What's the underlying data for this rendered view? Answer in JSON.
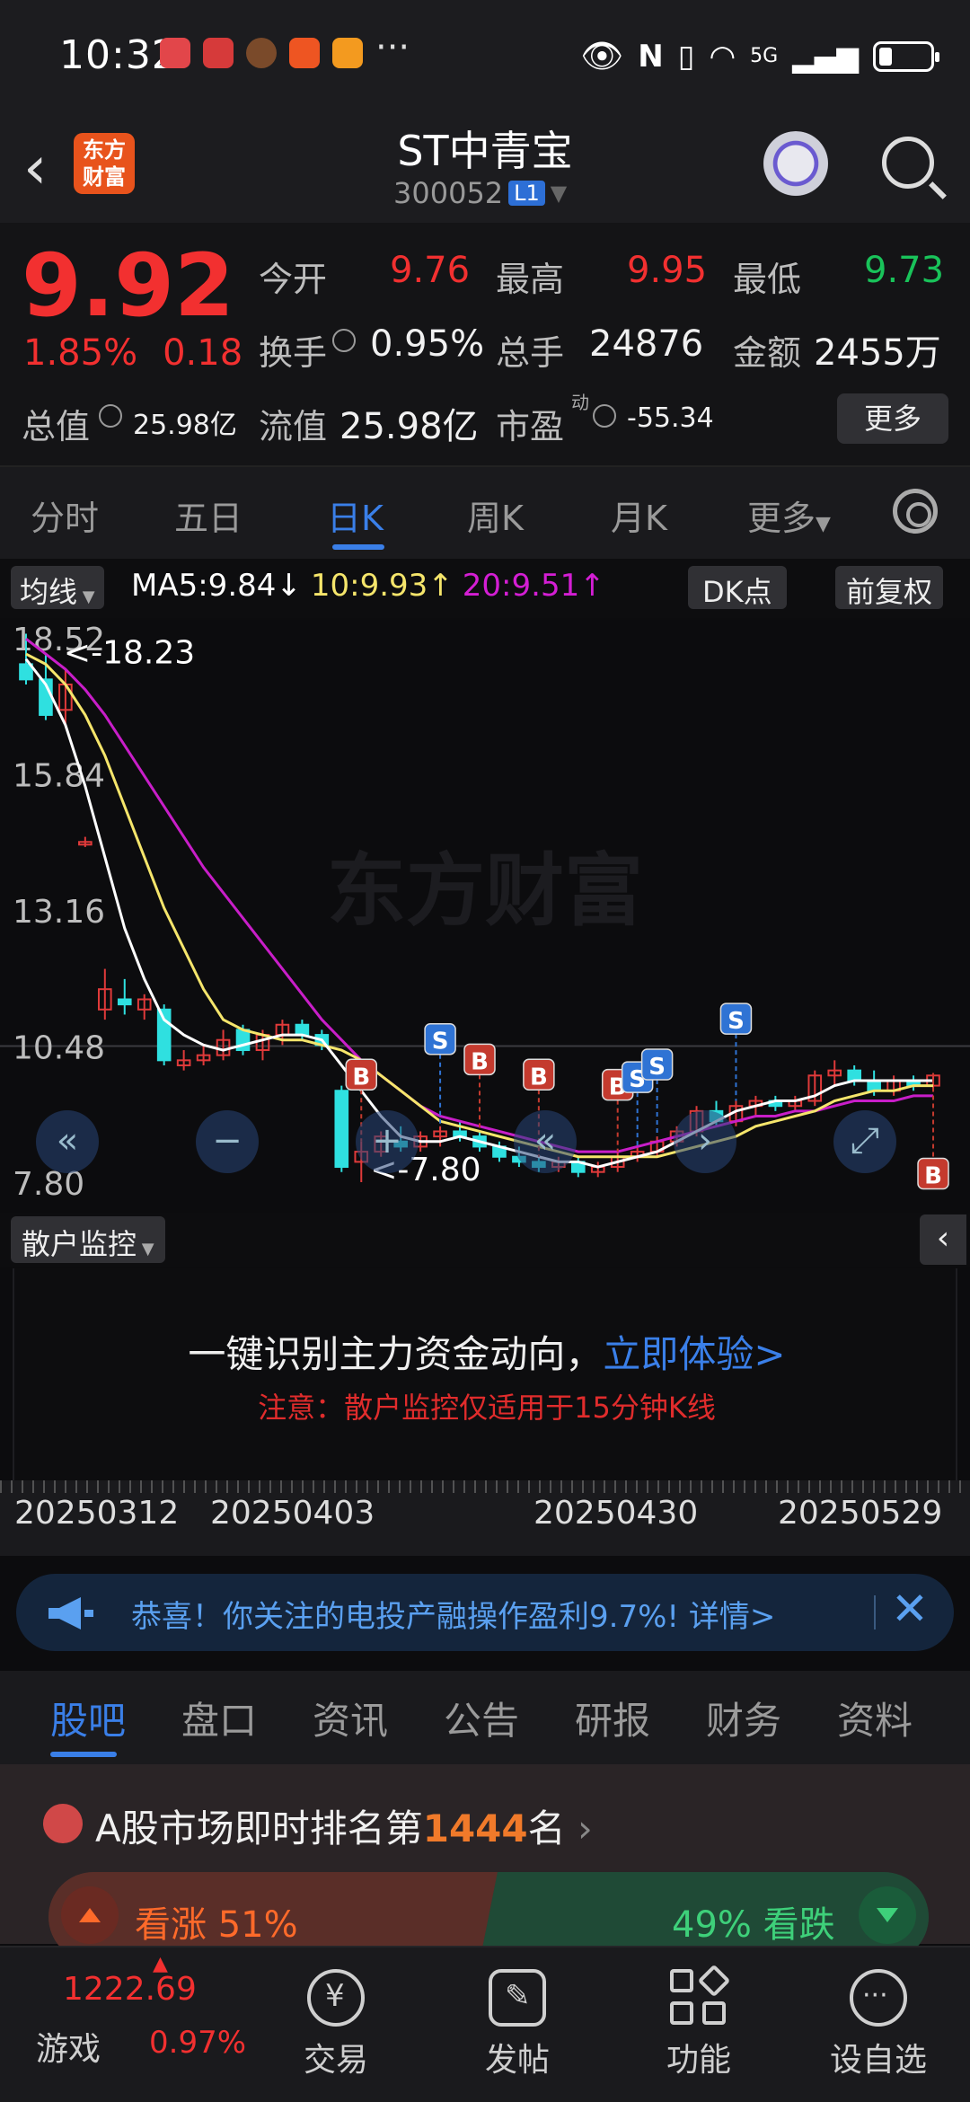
{
  "status_bar": {
    "time": "10:32",
    "dots": "···",
    "network": "5G"
  },
  "header": {
    "logo_line1": "东方",
    "logo_line2": "财富",
    "stock_name": "ST中青宝",
    "stock_code": "300052",
    "market_badge": "L1"
  },
  "quote": {
    "price": "9.92",
    "change_pct": "1.85%",
    "change_amt": "0.18",
    "open_label": "今开",
    "open": "9.76",
    "high_label": "最高",
    "high": "9.95",
    "low_label": "最低",
    "low": "9.73",
    "turnover_label": "换手",
    "turnover": "0.95%",
    "volume_label": "总手",
    "volume": "24876",
    "amount_label": "金额",
    "amount": "2455万",
    "mktcap_label": "总值",
    "mktcap": "25.98亿",
    "float_label": "流值",
    "float_cap": "25.98亿",
    "pe_label": "市盈",
    "pe_sup": "动",
    "pe": "-55.34",
    "more_label": "更多"
  },
  "period_tabs": [
    "分时",
    "五日",
    "日K",
    "周K",
    "月K",
    "更多"
  ],
  "period_active": "日K",
  "ma_bar": {
    "selector": "均线",
    "ma5": "MA5:9.84↓",
    "ma10": "10:9.93↑",
    "ma20": "20:9.51↑",
    "dk": "DK点",
    "adjust": "前复权"
  },
  "chart_data": {
    "type": "candlestick",
    "y_ticks": [
      "18.52",
      "15.84",
      "13.16",
      "10.48",
      "7.80"
    ],
    "high_annotation": "<-18.23",
    "low_annotation": "<-7.80",
    "watermark": "东方财富",
    "x_dates": [
      "20250312",
      "20250403",
      "20250430",
      "20250529"
    ],
    "colors": {
      "ma5": "#ffffff",
      "ma10": "#f5e56b",
      "ma20": "#c81ec8",
      "up": "#e03a3a",
      "down": "#2fe0e0"
    },
    "signals": [
      "B",
      "S",
      "B",
      "B",
      "B",
      "S",
      "S",
      "S",
      "B"
    ],
    "ohlc": [
      {
        "o": 18.0,
        "h": 18.6,
        "l": 17.6,
        "c": 17.7
      },
      {
        "o": 17.7,
        "h": 18.2,
        "l": 16.9,
        "c": 17.0
      },
      {
        "o": 17.1,
        "h": 17.9,
        "l": 16.8,
        "c": 17.6
      },
      {
        "o": 14.5,
        "h": 14.6,
        "l": 14.4,
        "c": 14.5
      },
      {
        "o": 11.2,
        "h": 12.0,
        "l": 11.0,
        "c": 11.6
      },
      {
        "o": 11.4,
        "h": 11.8,
        "l": 11.1,
        "c": 11.3
      },
      {
        "o": 11.2,
        "h": 11.5,
        "l": 11.0,
        "c": 11.4
      },
      {
        "o": 11.2,
        "h": 11.3,
        "l": 10.1,
        "c": 10.2
      },
      {
        "o": 10.1,
        "h": 10.4,
        "l": 10.0,
        "c": 10.2
      },
      {
        "o": 10.2,
        "h": 10.5,
        "l": 10.1,
        "c": 10.3
      },
      {
        "o": 10.3,
        "h": 10.8,
        "l": 10.2,
        "c": 10.6
      },
      {
        "o": 10.8,
        "h": 10.9,
        "l": 10.3,
        "c": 10.4
      },
      {
        "o": 10.4,
        "h": 10.8,
        "l": 10.2,
        "c": 10.7
      },
      {
        "o": 10.7,
        "h": 11.0,
        "l": 10.5,
        "c": 10.9
      },
      {
        "o": 10.9,
        "h": 11.0,
        "l": 10.6,
        "c": 10.7
      },
      {
        "o": 10.7,
        "h": 10.8,
        "l": 10.4,
        "c": 10.5
      },
      {
        "o": 9.6,
        "h": 9.7,
        "l": 8.0,
        "c": 8.1
      },
      {
        "o": 8.2,
        "h": 8.6,
        "l": 7.8,
        "c": 8.4
      },
      {
        "o": 8.4,
        "h": 8.8,
        "l": 8.3,
        "c": 8.7
      },
      {
        "o": 8.6,
        "h": 8.9,
        "l": 8.4,
        "c": 8.5
      },
      {
        "o": 8.5,
        "h": 8.8,
        "l": 8.4,
        "c": 8.7
      },
      {
        "o": 8.7,
        "h": 8.9,
        "l": 8.5,
        "c": 8.8
      },
      {
        "o": 8.8,
        "h": 9.0,
        "l": 8.6,
        "c": 8.7
      },
      {
        "o": 8.7,
        "h": 8.8,
        "l": 8.4,
        "c": 8.5
      },
      {
        "o": 8.5,
        "h": 8.6,
        "l": 8.2,
        "c": 8.3
      },
      {
        "o": 8.3,
        "h": 8.5,
        "l": 8.1,
        "c": 8.2
      },
      {
        "o": 8.2,
        "h": 8.3,
        "l": 8.0,
        "c": 8.1
      },
      {
        "o": 8.1,
        "h": 8.3,
        "l": 8.0,
        "c": 8.2
      },
      {
        "o": 8.2,
        "h": 8.3,
        "l": 7.9,
        "c": 8.0
      },
      {
        "o": 8.0,
        "h": 8.2,
        "l": 7.9,
        "c": 8.1
      },
      {
        "o": 8.1,
        "h": 8.4,
        "l": 8.0,
        "c": 8.3
      },
      {
        "o": 8.3,
        "h": 8.5,
        "l": 8.2,
        "c": 8.4
      },
      {
        "o": 8.4,
        "h": 8.7,
        "l": 8.3,
        "c": 8.6
      },
      {
        "o": 8.6,
        "h": 8.9,
        "l": 8.5,
        "c": 8.8
      },
      {
        "o": 8.8,
        "h": 9.3,
        "l": 8.7,
        "c": 9.2
      },
      {
        "o": 9.2,
        "h": 9.4,
        "l": 8.9,
        "c": 9.0
      },
      {
        "o": 9.0,
        "h": 9.4,
        "l": 8.9,
        "c": 9.3
      },
      {
        "o": 9.3,
        "h": 9.5,
        "l": 9.1,
        "c": 9.4
      },
      {
        "o": 9.4,
        "h": 9.5,
        "l": 9.2,
        "c": 9.3
      },
      {
        "o": 9.3,
        "h": 9.5,
        "l": 9.2,
        "c": 9.4
      },
      {
        "o": 9.4,
        "h": 10.0,
        "l": 9.3,
        "c": 9.9
      },
      {
        "o": 9.9,
        "h": 10.2,
        "l": 9.7,
        "c": 10.0
      },
      {
        "o": 10.0,
        "h": 10.1,
        "l": 9.7,
        "c": 9.8
      },
      {
        "o": 9.8,
        "h": 10.0,
        "l": 9.5,
        "c": 9.6
      },
      {
        "o": 9.6,
        "h": 9.9,
        "l": 9.5,
        "c": 9.8
      },
      {
        "o": 9.8,
        "h": 9.9,
        "l": 9.6,
        "c": 9.7
      },
      {
        "o": 9.7,
        "h": 9.95,
        "l": 9.6,
        "c": 9.9
      }
    ],
    "ma5": [
      18.1,
      17.6,
      16.8,
      15.6,
      14.2,
      12.8,
      11.8,
      11.0,
      10.7,
      10.5,
      10.4,
      10.5,
      10.6,
      10.7,
      10.7,
      10.6,
      10.1,
      9.6,
      9.1,
      8.7,
      8.6,
      8.6,
      8.7,
      8.6,
      8.5,
      8.4,
      8.3,
      8.2,
      8.2,
      8.1,
      8.2,
      8.3,
      8.4,
      8.6,
      8.8,
      9.0,
      9.2,
      9.3,
      9.4,
      9.4,
      9.5,
      9.7,
      9.8,
      9.8,
      9.8,
      9.8,
      9.8
    ],
    "ma10": [
      18.2,
      18.0,
      17.6,
      17.0,
      16.2,
      15.2,
      14.2,
      13.2,
      12.4,
      11.6,
      11.0,
      10.8,
      10.7,
      10.6,
      10.6,
      10.5,
      10.4,
      10.2,
      9.9,
      9.6,
      9.3,
      9.0,
      8.9,
      8.8,
      8.7,
      8.6,
      8.5,
      8.4,
      8.3,
      8.3,
      8.3,
      8.3,
      8.3,
      8.4,
      8.5,
      8.6,
      8.7,
      8.9,
      9.0,
      9.1,
      9.2,
      9.4,
      9.5,
      9.6,
      9.6,
      9.7,
      9.7
    ],
    "ma20": [
      18.5,
      18.2,
      17.9,
      17.5,
      17.0,
      16.4,
      15.8,
      15.2,
      14.6,
      14.0,
      13.5,
      13.0,
      12.5,
      12.0,
      11.5,
      11.0,
      10.6,
      10.2,
      9.9,
      9.6,
      9.3,
      9.1,
      9.0,
      8.9,
      8.8,
      8.7,
      8.6,
      8.5,
      8.4,
      8.4,
      8.4,
      8.5,
      8.6,
      8.7,
      8.8,
      8.9,
      9.0,
      9.1,
      9.1,
      9.2,
      9.2,
      9.3,
      9.4,
      9.4,
      9.4,
      9.5,
      9.5
    ]
  },
  "monitor": {
    "selector": "散户监控",
    "headline": "一键识别主力资金动向，",
    "cta": "立即体验>",
    "note": "注意：散户监控仅适用于15分钟K线"
  },
  "notice": {
    "text": "恭喜！你关注的电投产融操作盈利9.7%! 详情>"
  },
  "content_tabs": [
    "股吧",
    "盘口",
    "资讯",
    "公告",
    "研报",
    "财务",
    "资料"
  ],
  "rank": {
    "prefix": "A股市场即时排名第",
    "number": "1444",
    "suffix": "名"
  },
  "sentiment": {
    "bull_label": "看涨",
    "bull_pct": "51%",
    "bear_label": "看跌",
    "bear_pct": "49%",
    "bull_value": 51
  },
  "bottom_nav": {
    "index_value": "1222.69",
    "index_name": "游戏",
    "index_change": "0.97%",
    "items": [
      "交易",
      "发帖",
      "功能",
      "设自选"
    ]
  }
}
